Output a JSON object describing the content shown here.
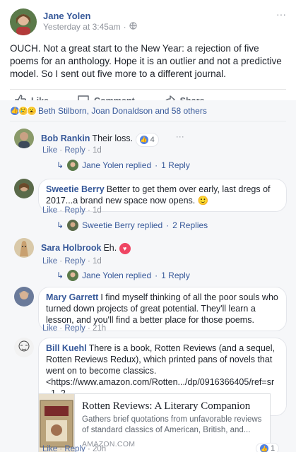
{
  "post": {
    "author": "Jane Yolen",
    "timestamp": "Yesterday at 3:45am",
    "privacy_separator": "·",
    "privacy_icon": "globe-icon",
    "menu": "···",
    "text": "OUCH. Not a great start to the New Year: a rejection of five poems for an anthology. Hope it is an outlier and not a predictive model. So I sent out five more to a different journal.",
    "actions": {
      "like": "Like",
      "comment": "Comment",
      "share": "Share"
    }
  },
  "reactions": {
    "summary": "Beth Stilborn, Joan Donaldson and 58 others"
  },
  "comments": [
    {
      "author": "Bob Rankin",
      "text": "Their loss.",
      "likes": "4",
      "menu": "···",
      "like_label": "Like",
      "reply_label": "Reply",
      "age": "1d",
      "replied_by": "Jane Yolen replied",
      "replies": "1 Reply"
    },
    {
      "author": "Sweetie Berry",
      "text": "Better to get them over early, last dregs of 2017...a brand new space now opens.",
      "emoji": "🙂",
      "like_label": "Like",
      "reply_label": "Reply",
      "age": "1d",
      "replied_by": "Sweetie Berry replied",
      "replies": "2 Replies"
    },
    {
      "author": "Sara Holbrook",
      "text": "Eh.",
      "like_label": "Like",
      "reply_label": "Reply",
      "age": "1d",
      "replied_by": "Jane Yolen replied",
      "replies": "1 Reply"
    },
    {
      "author": "Mary Garrett",
      "text": "I find myself thinking of all the poor souls who turned down projects of great potential. They'll learn a lesson, and you'll find a better place for those poems.",
      "like_label": "Like",
      "reply_label": "Reply",
      "age": "21h"
    },
    {
      "author": "Bill Kuehl",
      "text": "There is a book, Rotten Reviews (and a sequel, Rotten Reviews Redux), which printed pans of novels that went on to become classics.",
      "link": "<https://www.amazon.com/Rotten.../dp/0916366405/ref=sr_1_2..",
      "link_end": ".>",
      "like_label": "Like",
      "reply_label": "Reply",
      "age": "20h",
      "likes": "1"
    }
  ],
  "link_card": {
    "title": "Rotten Reviews: A Literary Companion",
    "description": "Gathers brief quotations from unfavorable reviews of standard classics of American, British, and...",
    "source": "AMAZON.COM"
  },
  "colors": {
    "link_blue": "#365899",
    "meta_gray": "#90949c",
    "like_blue": "#4f81e6",
    "heart_red": "#ef4563"
  }
}
